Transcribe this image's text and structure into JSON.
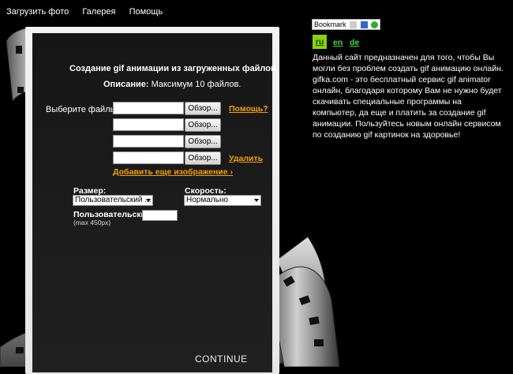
{
  "nav": {
    "items": [
      "Загрузить фото",
      "Галерея",
      "Помощь"
    ]
  },
  "form": {
    "title": "Создание gif анимации из загруженных файлов",
    "description_label": "Описание:",
    "description_text": " Максимум 10 файлов.",
    "choose_files_label": "Выберите файлы:",
    "browse_label": "Обзор...",
    "help_link": "Помощь?",
    "delete_link": "Удалить",
    "add_image_link": "Добавить еще изображение ›",
    "size_label": "Размер:",
    "size_value": "Пользовательский ...",
    "speed_label": "Скорость:",
    "speed_value": "Нормально",
    "custom_label": "Пользовательский:",
    "custom_note": "(max 450px)",
    "continue_label": "CONTINUE"
  },
  "sidebar": {
    "bookmark_label": "Bookmark",
    "languages": [
      "ru",
      "en",
      "de"
    ],
    "active_language": "ru",
    "info_text": "Данный сайт предназначен для того, чтобы Вы могли без проблем создать gif анимацию онлайн. gifka.com - это бесплатный сервис gif animator онлайн, благодаря которому Вам не нужно будет скачивать специальные программы на компьютер, да еще и платить за создание gif анимации. Пользуйтесь новым онлайн сервисом по созданию gif картинок на здоровье!"
  },
  "colors": {
    "accent": "#f5a100",
    "lang_active_bg": "#8bd10d",
    "lang_link": "#4ad94a"
  }
}
